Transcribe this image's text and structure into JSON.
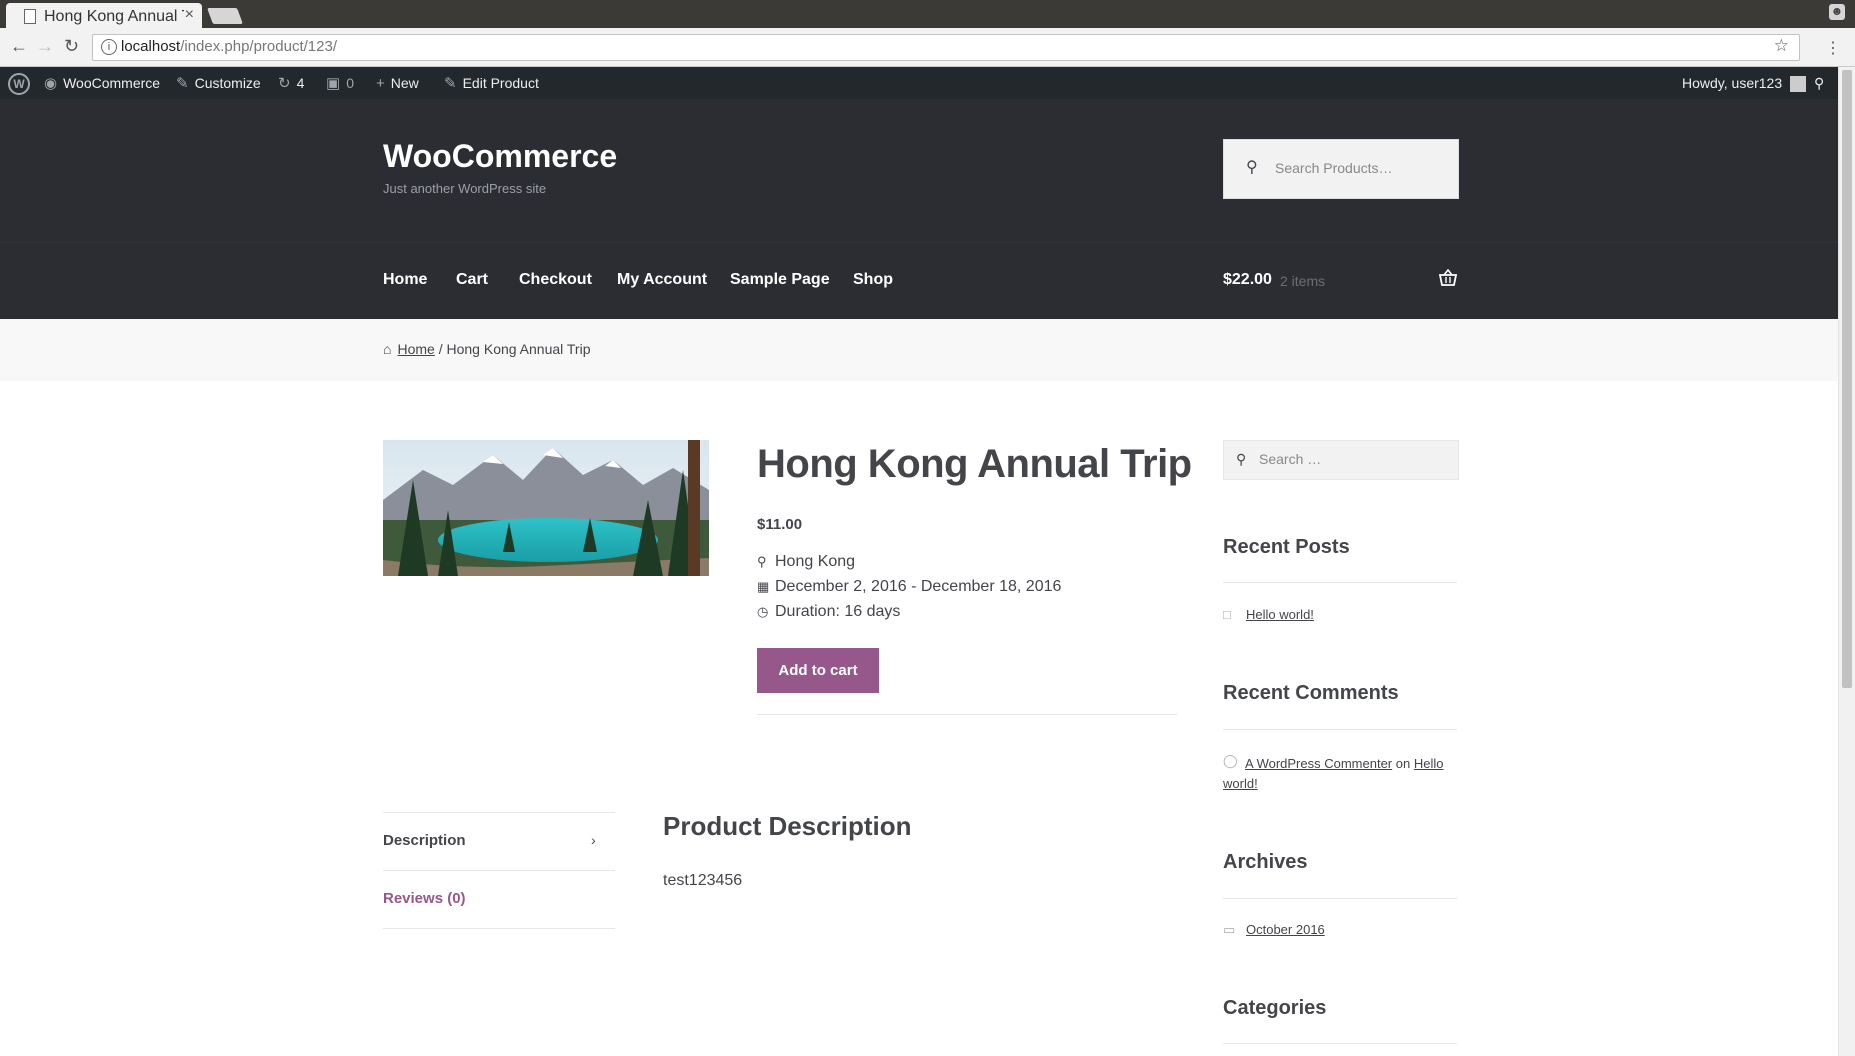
{
  "browser": {
    "tab_title": "Hong Kong Annual Trip",
    "tab_close": "×",
    "url_host": "localhost",
    "url_path": "/index.php/product/123/",
    "star": "☆",
    "menu": "⋮"
  },
  "admin_bar": {
    "wp_logo": "W",
    "site_name": "WooCommerce",
    "customize": "Customize",
    "updates_count": "4",
    "comments_count": "0",
    "new_label": "New",
    "edit_label": "Edit Product",
    "howdy": "Howdy, user123"
  },
  "header": {
    "site_title": "WooCommerce",
    "site_description": "Just another WordPress site",
    "search_placeholder": "Search Products…"
  },
  "nav": {
    "items": [
      "Home",
      "Cart",
      "Checkout",
      "My Account",
      "Sample Page",
      "Shop"
    ]
  },
  "cart": {
    "total": "$22.00",
    "count": "2 items"
  },
  "breadcrumb": {
    "home": "Home",
    "separator": "/",
    "current": "Hong Kong Annual Trip"
  },
  "product": {
    "title": "Hong Kong Annual Trip",
    "price": "$11.00",
    "location": "Hong Kong",
    "dates": "December 2, 2016 - December 18, 2016",
    "duration": "Duration: 16 days",
    "add_to_cart": "Add to cart"
  },
  "tabs": {
    "description": "Description",
    "reviews": "Reviews (0)",
    "desc_heading": "Product Description",
    "desc_text": "test123456"
  },
  "sidebar": {
    "search_placeholder": "Search …",
    "recent_posts_title": "Recent Posts",
    "recent_post": "Hello world!",
    "recent_comments_title": "Recent Comments",
    "comment_author": "A WordPress Commenter",
    "comment_on": "on",
    "comment_post_1": "Hello",
    "comment_post_2": "world!",
    "archives_title": "Archives",
    "archive_item": "October 2016",
    "categories_title": "Categories"
  },
  "colors": {
    "header_bg": "#2c2d33",
    "accent": "#96588a",
    "admin_bar_bg": "#23282d"
  }
}
